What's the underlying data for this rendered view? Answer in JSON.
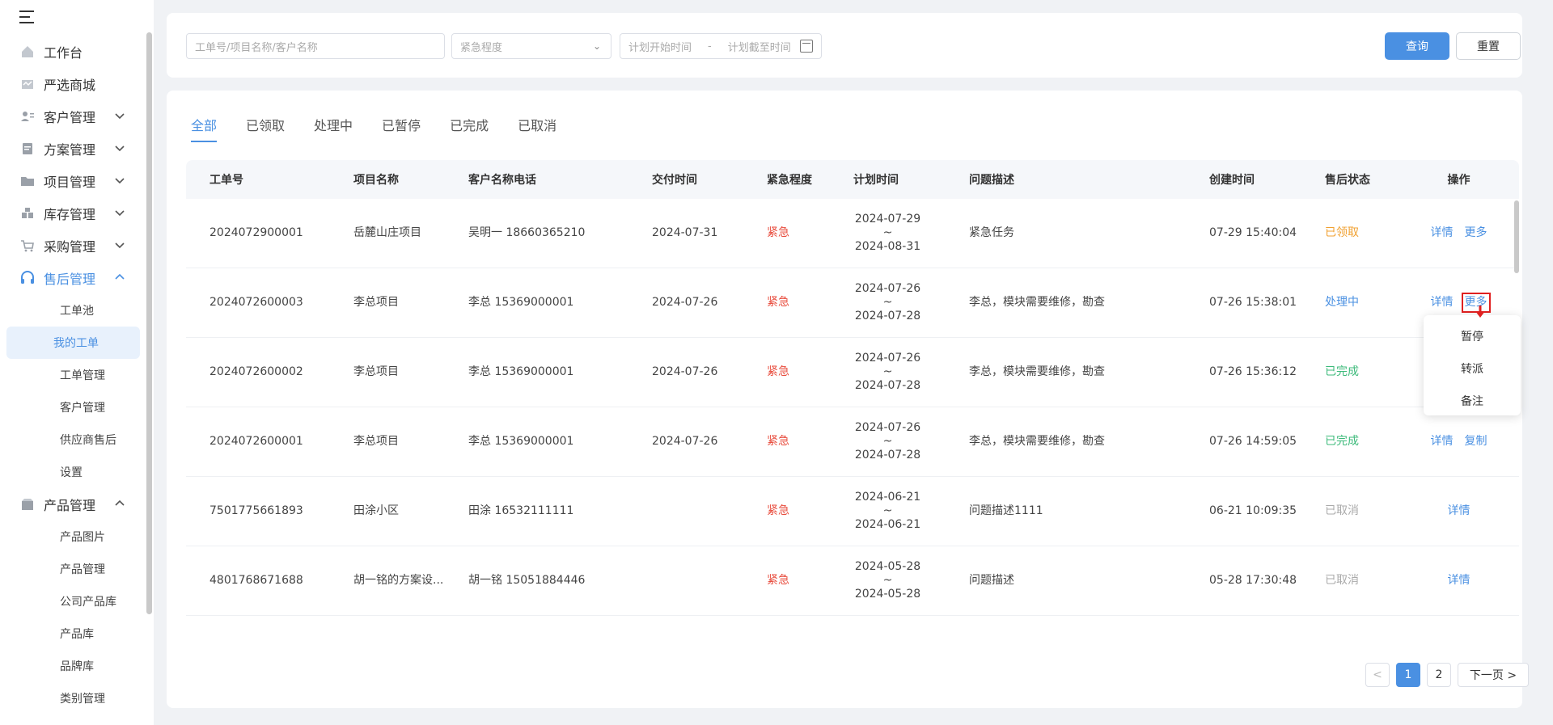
{
  "sidebar": {
    "menu": [
      {
        "label": "工作台",
        "icon": "home-icon"
      },
      {
        "label": "严选商城",
        "icon": "store-icon"
      },
      {
        "label": "客户管理",
        "icon": "customer-icon",
        "expandable": true
      },
      {
        "label": "方案管理",
        "icon": "document-icon",
        "expandable": true
      },
      {
        "label": "项目管理",
        "icon": "folder-icon",
        "expandable": true
      },
      {
        "label": "库存管理",
        "icon": "warehouse-icon",
        "expandable": true
      },
      {
        "label": "采购管理",
        "icon": "cart-icon",
        "expandable": true
      },
      {
        "label": "售后管理",
        "icon": "headset-icon",
        "expandable": true,
        "expanded": true
      }
    ],
    "after_sales_sub": [
      "工单池",
      "我的工单",
      "工单管理",
      "客户管理",
      "供应商售后",
      "设置"
    ],
    "product_menu": {
      "label": "产品管理",
      "icon": "box-icon"
    },
    "product_sub": [
      "产品图片",
      "产品管理",
      "公司产品库",
      "产品库",
      "品牌库",
      "类别管理"
    ]
  },
  "filters": {
    "keyword_placeholder": "工单号/项目名称/客户名称",
    "urgency_placeholder": "紧急程度",
    "start_placeholder": "计划开始时间",
    "date_sep": "-",
    "end_placeholder": "计划截至时间",
    "query_label": "查询",
    "reset_label": "重置"
  },
  "tabs": [
    "全部",
    "已领取",
    "处理中",
    "已暂停",
    "已完成",
    "已取消"
  ],
  "table": {
    "headers": [
      "工单号",
      "项目名称",
      "客户名称电话",
      "交付时间",
      "紧急程度",
      "计划时间",
      "问题描述",
      "创建时间",
      "售后状态",
      "操作"
    ],
    "rows": [
      {
        "id": "2024072900001",
        "project": "岳麓山庄项目",
        "customer": "吴明一  18660365210",
        "delivery": "2024-07-31",
        "urgency": "紧急",
        "plan_start": "2024-07-29",
        "plan_end": "2024-08-31",
        "desc": "紧急任务",
        "created": "07-29 15:40:04",
        "status": "已领取",
        "ops": [
          "详情",
          "更多"
        ]
      },
      {
        "id": "2024072600003",
        "project": "李总项目",
        "customer": "李总  15369000001",
        "delivery": "2024-07-26",
        "urgency": "紧急",
        "plan_start": "2024-07-26",
        "plan_end": "2024-07-28",
        "desc": "李总，模块需要维修，勘查",
        "created": "07-26 15:38:01",
        "status": "处理中",
        "ops": [
          "详情",
          "更多"
        ]
      },
      {
        "id": "2024072600002",
        "project": "李总项目",
        "customer": "李总  15369000001",
        "delivery": "2024-07-26",
        "urgency": "紧急",
        "plan_start": "2024-07-26",
        "plan_end": "2024-07-28",
        "desc": "李总，模块需要维修，勘查",
        "created": "07-26 15:36:12",
        "status": "已完成",
        "ops": []
      },
      {
        "id": "2024072600001",
        "project": "李总项目",
        "customer": "李总  15369000001",
        "delivery": "2024-07-26",
        "urgency": "紧急",
        "plan_start": "2024-07-26",
        "plan_end": "2024-07-28",
        "desc": "李总，模块需要维修，勘查",
        "created": "07-26 14:59:05",
        "status": "已完成",
        "ops": [
          "详情",
          "复制"
        ]
      },
      {
        "id": "7501775661893",
        "project": "田涂小区",
        "customer": "田涂  16532111111",
        "delivery": "",
        "urgency": "紧急",
        "plan_start": "2024-06-21",
        "plan_end": "2024-06-21",
        "desc": "问题描述1111",
        "created": "06-21 10:09:35",
        "status": "已取消",
        "ops": [
          "详情"
        ]
      },
      {
        "id": "4801768671688",
        "project": "胡一铭的方案设...",
        "customer": "胡一铭  15051884446",
        "delivery": "",
        "urgency": "紧急",
        "plan_start": "2024-05-28",
        "plan_end": "2024-05-28",
        "desc": "问题描述",
        "created": "05-28 17:30:48",
        "status": "已取消",
        "ops": [
          "详情"
        ]
      }
    ],
    "plan_sep": "~"
  },
  "dropdown": [
    "暂停",
    "转派",
    "备注"
  ],
  "pager": {
    "prev": "<",
    "pages": [
      "1",
      "2"
    ],
    "next": "下一页 >"
  },
  "colors": {
    "primary": "#4a90e2",
    "urgent": "#e84c3d",
    "received": "#f0a030",
    "done": "#3cba7a",
    "cancelled": "#aaaaaa"
  }
}
